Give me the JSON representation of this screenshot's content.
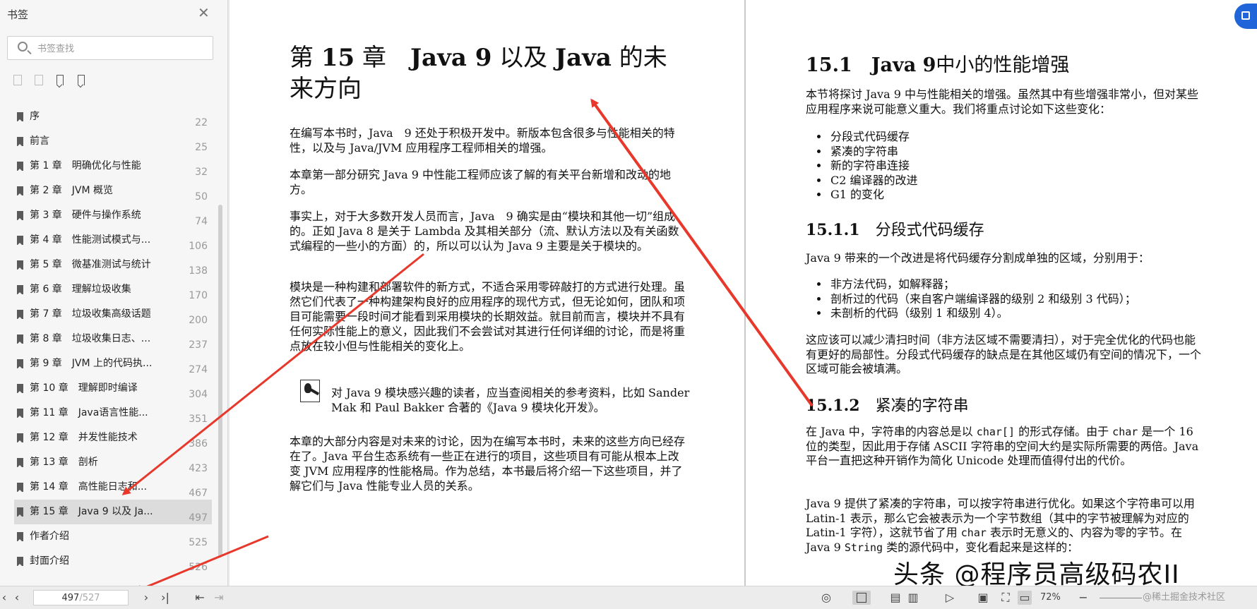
{
  "sidebar": {
    "title": "书签",
    "search_placeholder": "书签查找",
    "items": [
      {
        "label": "序",
        "page": "22"
      },
      {
        "label": "前言",
        "page": "25"
      },
      {
        "label": "第 1 章　明确优化与性能",
        "page": "32"
      },
      {
        "label": "第 2 章　JVM 概览",
        "page": "50"
      },
      {
        "label": "第 3 章　硬件与操作系统",
        "page": "74"
      },
      {
        "label": "第 4 章　性能测试模式与...",
        "page": "106"
      },
      {
        "label": "第 5 章　微基准测试与统计",
        "page": "138"
      },
      {
        "label": "第 6 章　理解垃圾收集",
        "page": "170"
      },
      {
        "label": "第 7 章　垃圾收集高级话题",
        "page": "200"
      },
      {
        "label": "第 8 章　垃圾收集日志、...",
        "page": "237"
      },
      {
        "label": "第 9 章　JVM 上的代码执...",
        "page": "274"
      },
      {
        "label": "第 10 章　理解即时编译",
        "page": "304"
      },
      {
        "label": "第 11 章　Java语言性能...",
        "page": "351"
      },
      {
        "label": "第 12 章　并发性能技术",
        "page": "386"
      },
      {
        "label": "第 13 章　剖析",
        "page": "423"
      },
      {
        "label": "第 14 章　高性能日志和...",
        "page": "467"
      },
      {
        "label": "第 15 章　Java 9 以及 Ja...",
        "page": "497"
      },
      {
        "label": "作者介绍",
        "page": "525"
      },
      {
        "label": "封面介绍",
        "page": "526"
      }
    ],
    "active_index": 16
  },
  "left_page": {
    "chapter_title_pre": "第",
    "chapter_num": "15",
    "chapter_title_mid": "章　",
    "chapter_title_java9": "Java 9",
    "chapter_title_and": " 以及 ",
    "chapter_title_java": "Java",
    "chapter_title_rest": " 的未来方向",
    "p1": "在编写本书时，Java　9 还处于积极开发中。新版本包含很多与性能相关的特性，以及与 Java/JVM 应用程序工程师相关的增强。",
    "p2": "本章第一部分研究 Java 9 中性能工程师应该了解的有关平台新增和改动的地方。",
    "p3": "事实上，对于大多数开发人员而言，Java　9 确实是由“模块和其他一切”组成的。正如 Java 8 是关于 Lambda 及其相关部分（流、默认方法以及有关函数式编程的一些小的方面）的，所以可以认为 Java 9 主要是关于模块的。",
    "p4": "模块是一种构建和部署软件的新方式，不适合采用零碎敲打的方式进行处理。虽然它们代表了一种构建架构良好的应用程序的现代方式，但无论如何，团队和项目可能需要一段时间才能看到采用模块的长期效益。就目前而言，模块并不具有任何实际性能上的意义，因此我们不会尝试对其进行任何详细的讨论，而是将重点放在较小但与性能相关的变化上。",
    "note": "对 Java 9 模块感兴趣的读者，应当查阅相关的参考资料，比如 Sander Mak 和 Paul Bakker 合著的《Java 9 模块化开发》。",
    "p5": "本章的大部分内容是对未来的讨论，因为在编写本书时，未来的这些方向已经存在了。Java 平台生态系统有一些正在进行的项目，这些项目有可能从根本上改变 JVM 应用程序的性能格局。作为总结，本书最后将介绍一下这些项目，并了解它们与 Java 性能专业人员的关系。"
  },
  "right_page": {
    "h1_num": "15.1",
    "h1_java": "Java 9",
    "h1_rest": "中小的性能增强",
    "intro": "本节将探讨 Java 9 中与性能相关的增强。虽然其中有些增强非常小，但对某些应用程序来说可能意义重大。我们将重点讨论如下这些变化：",
    "list1": [
      "分段式代码缓存",
      "紧凑的字符串",
      "新的字符串连接",
      "C2 编译器的改进",
      "G1 的变化"
    ],
    "h2a_num": "15.1.1",
    "h2a_title": "分段式代码缓存",
    "p_a": "Java 9 带来的一个改进是将代码缓存分割成单独的区域，分别用于：",
    "list2": [
      "非方法代码，如解释器；",
      "剖析过的代码（来自客户端编译器的级别 2 和级别 3 代码）；",
      "未剖析的代码（级别 1 和级别 4）。"
    ],
    "p_b": "这应该可以减少清扫时间（非方法区域不需要清扫），对于完全优化的代码也能有更好的局部性。分段式代码缓存的缺点是在其他区域仍有空间的情况下，一个区域可能会被填满。",
    "h2b_num": "15.1.2",
    "h2b_title": "紧凑的字符串",
    "p_c1": "在 Java 中，字符串的内容总是以 ",
    "p_c_code1": "char[]",
    "p_c2": " 的形式存储。由于 ",
    "p_c_code2": "char",
    "p_c3": " 是一个 16 位的类型，因此用于存储 ASCII 字符串的空间大约是实际所需要的两倍。Java 平台一直把这种开销作为简化 Unicode 处理而值得付出的代价。",
    "p_d1": "Java 9 提供了紧凑的字符串，可以按字符串进行优化。如果这个字符串可以用 Latin-1 表示，那么它会被表示为一个字节数组（其中的字节被理解为对应的 Latin-1 字符），这就节省了用 ",
    "p_d_code1": "char",
    "p_d2": " 表示时无意义的、内容为零的字节。在 Java 9 ",
    "p_d_code2": "String",
    "p_d3": " 类的源代码中，变化看起来是这样的："
  },
  "bottombar": {
    "current_page": "497",
    "total_pages": "/527",
    "zoom": "72%"
  },
  "watermark": "头条 @程序员高级码农II",
  "watermark2": "@稀土掘金技术社区",
  "colors": {
    "arrow": "#e8382c",
    "active_bg": "#dcdcdc",
    "accent": "#1f64d8"
  }
}
